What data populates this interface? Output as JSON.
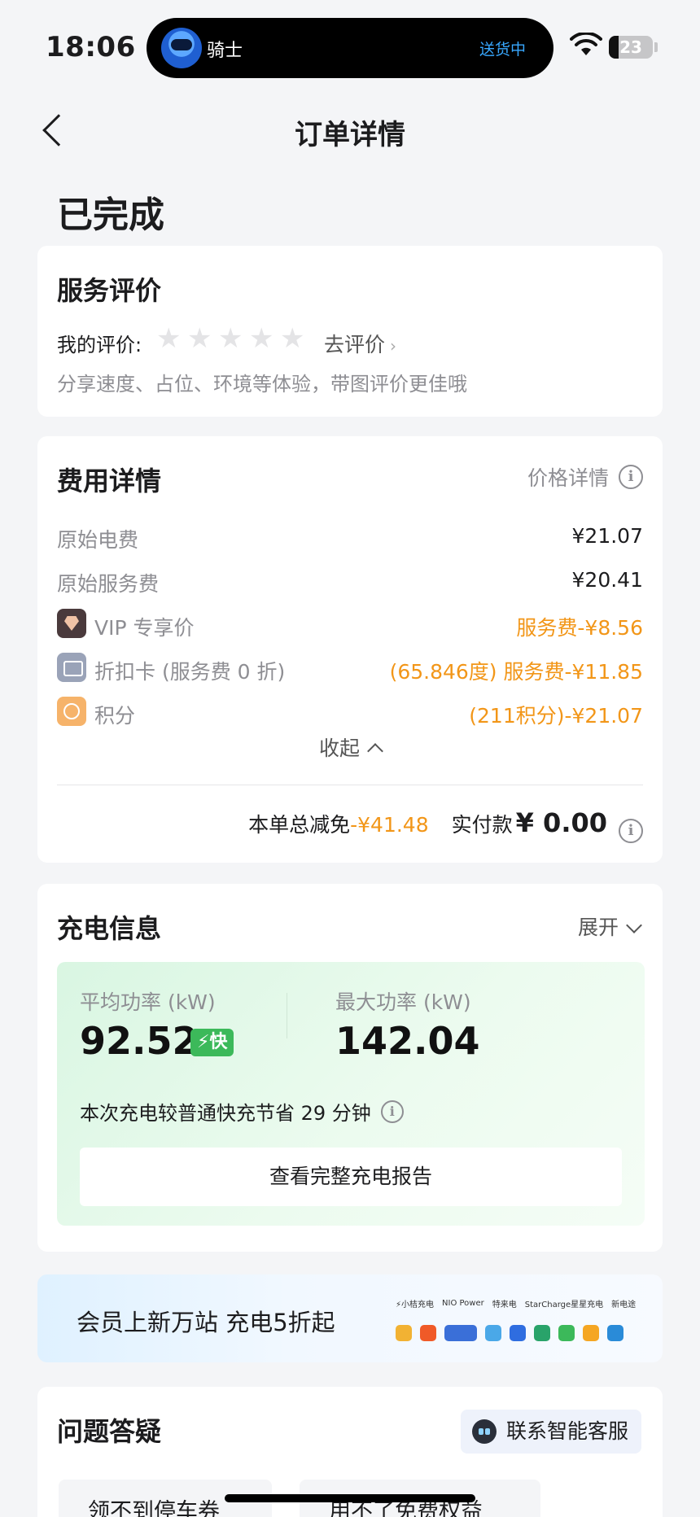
{
  "statusbar": {
    "time": "18:06",
    "island_name": "骑士",
    "island_status": "送货中",
    "battery": "23",
    "battery_level_percent": 23
  },
  "nav": {
    "title": "订单详情",
    "back_icon": "chevron-left-icon"
  },
  "order_status": "已完成",
  "rating": {
    "title": "服务评价",
    "my_rating_label": "我的评价:",
    "stars_filled": 0,
    "stars_total": 5,
    "go_rate": "去评价",
    "hint": "分享速度、占位、环境等体验，带图评价更佳哦"
  },
  "fee": {
    "title": "费用详情",
    "price_detail": "价格详情",
    "rows": [
      {
        "label": "原始电费",
        "value": "¥21.07"
      },
      {
        "label": "原始服务费",
        "value": "¥20.41"
      },
      {
        "label": "VIP 专享价",
        "value": "服务费-¥8.56",
        "icon": "vip-icon"
      },
      {
        "label": "折扣卡 (服务费 0 折)",
        "value": "(65.846度) 服务费-¥11.85",
        "icon": "card-icon"
      },
      {
        "label": "积分",
        "value": "(211积分)-¥21.07",
        "icon": "points-icon"
      }
    ],
    "collapse": "收起",
    "discount_label": "本单总减免",
    "discount": "-¥41.48",
    "paid_label": "实付款",
    "paid": "¥ 0.00",
    "accent_color": "#f29618"
  },
  "charge": {
    "title": "充电信息",
    "expand": "展开",
    "avg_label": "平均功率 (kW)",
    "avg_value": "92.52",
    "fast_badge": "⚡快",
    "max_label": "最大功率 (kW)",
    "max_value": "142.04",
    "save_note": "本次充电较普通快充节省 29 分钟",
    "report_button": "查看完整充电报告"
  },
  "banner": {
    "text": "会员上新万站 充电5折起",
    "brands_row1": [
      "⚡小桔充电",
      "NIO Power",
      "特来电",
      "StarCharge星星充电",
      "新电途"
    ],
    "brands_row2": []
  },
  "faq": {
    "title": "问题答疑",
    "cs_button": "联系智能客服",
    "chips": [
      "领不到停车券",
      "用不了免费权益"
    ]
  }
}
